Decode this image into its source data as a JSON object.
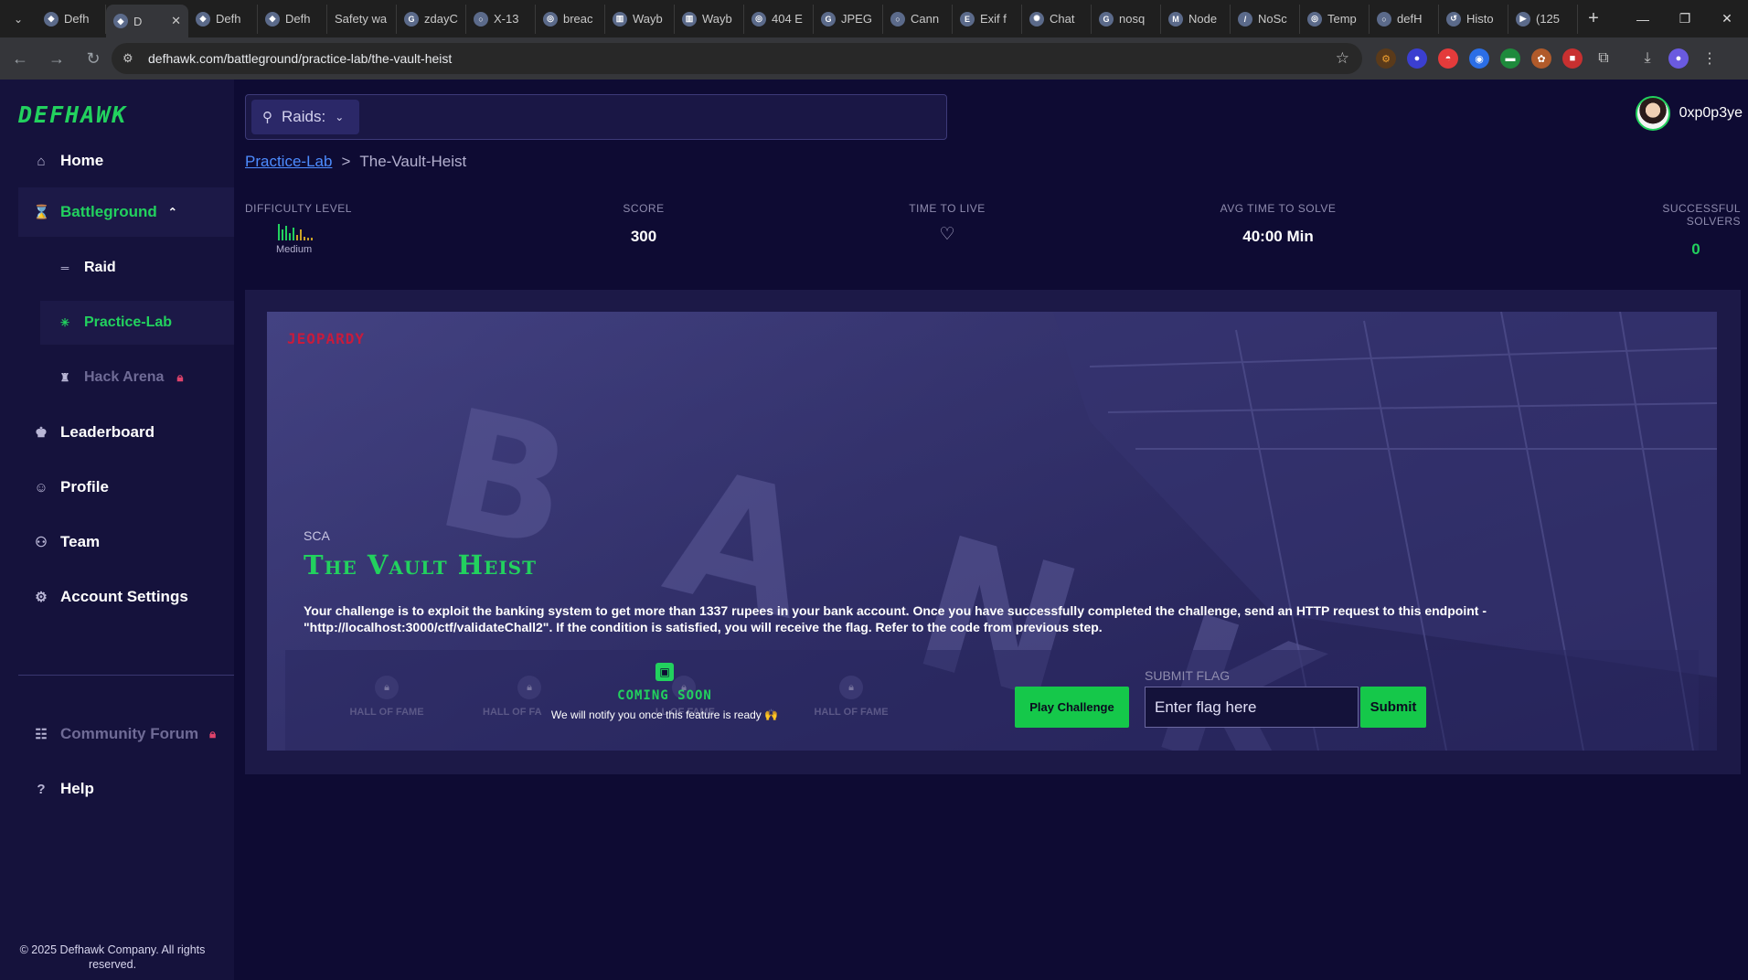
{
  "browser": {
    "tabs": [
      {
        "label": "Defh",
        "icon": "shield-icon"
      },
      {
        "label": "D",
        "icon": "shield-icon",
        "active": true
      },
      {
        "label": "Defh",
        "icon": "shield-icon"
      },
      {
        "label": "Defh",
        "icon": "shield-icon"
      },
      {
        "label": "Safety wa",
        "icon": ""
      },
      {
        "label": "zdayC",
        "icon": "google-icon"
      },
      {
        "label": "X-13",
        "icon": "github-icon"
      },
      {
        "label": "breac",
        "icon": "globe-icon"
      },
      {
        "label": "Wayb",
        "icon": "archive-icon"
      },
      {
        "label": "Wayb",
        "icon": "archive-icon"
      },
      {
        "label": "404 E",
        "icon": "globe-icon"
      },
      {
        "label": "JPEG",
        "icon": "google-icon"
      },
      {
        "label": "Cann",
        "icon": "github-icon"
      },
      {
        "label": "Exif f",
        "icon": "exif-icon"
      },
      {
        "label": "Chat",
        "icon": "openai-icon"
      },
      {
        "label": "nosq",
        "icon": "google-icon"
      },
      {
        "label": "Node",
        "icon": "medium-icon"
      },
      {
        "label": "NoSc",
        "icon": "feather-icon"
      },
      {
        "label": "Temp",
        "icon": "globe-icon"
      },
      {
        "label": "defH",
        "icon": "github-icon"
      },
      {
        "label": "Histo",
        "icon": "history-icon"
      },
      {
        "label": "(125",
        "icon": "youtube-icon"
      }
    ],
    "url": "defhawk.com/battleground/practice-lab/the-vault-heist"
  },
  "sidebar": {
    "logo": "DEFHAWK",
    "items": {
      "home": "Home",
      "battleground": "Battleground",
      "raid": "Raid",
      "practice_lab": "Practice-Lab",
      "hack_arena": "Hack Arena",
      "leaderboard": "Leaderboard",
      "profile": "Profile",
      "team": "Team",
      "account_settings": "Account Settings",
      "community_forum": "Community Forum",
      "help": "Help"
    },
    "copyright": "© 2025 Defhawk Company. All rights reserved."
  },
  "header": {
    "search_select": "Raids:",
    "username": "0xp0p3ye"
  },
  "breadcrumb": {
    "parent": "Practice-Lab",
    "separator": ">",
    "current": "The-Vault-Heist"
  },
  "stats": {
    "difficulty_label": "DIFFICULTY LEVEL",
    "difficulty_value": "Medium",
    "score_label": "SCORE",
    "score_value": "300",
    "ttl_label": "TIME TO LIVE",
    "avg_label": "AVG TIME TO SOLVE",
    "avg_value": "40:00 Min",
    "solvers_label": "SUCCESSFUL SOLVERS",
    "solvers_value": "0"
  },
  "challenge": {
    "tag": "JEOPARDY",
    "category": "SCA",
    "title": "The Vault Heist",
    "description": "Your challenge is to exploit the banking system to get more than 1337 rupees in your bank account. Once you have successfully completed the challenge, send an HTTP request to this endpoint - \"http://localhost:3000/ctf/validateChall2\". If the condition is satisfied, you will receive the flag. Refer to the code from previous step.",
    "hall_of_fame": [
      "HALL OF FAME",
      "HALL OF FA",
      "LL OF FAME",
      "HALL OF FAME"
    ],
    "coming_soon_title": "COMING SOON",
    "coming_soon_note": "We will notify you once this feature is ready 🙌",
    "play_button": "Play Challenge",
    "submit_flag_label": "SUBMIT FLAG",
    "flag_placeholder": "Enter flag here",
    "submit_button": "Submit"
  },
  "colors": {
    "accent": "#22d15e",
    "background": "#0e0b33",
    "sidebar": "#15123c",
    "tag": "#c71b3c",
    "link": "#4d8cff"
  }
}
